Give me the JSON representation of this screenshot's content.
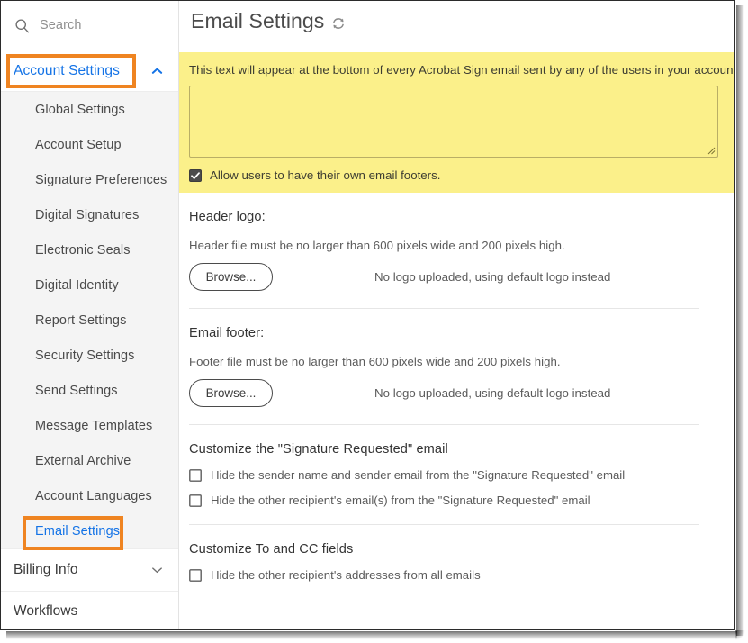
{
  "colors": {
    "accent_orange": "#ef8421",
    "link_blue": "#1473e6",
    "highlight_yellow": "#fbf08a",
    "sidebar_bg": "#f4f4f4"
  },
  "sidebar": {
    "search": {
      "placeholder": "Search",
      "icon": "search-icon"
    },
    "account_settings": {
      "label": "Account Settings",
      "expanded": true,
      "chevron_icon": "chevron-up-icon",
      "highlighted": true
    },
    "items": [
      {
        "label": "Global Settings",
        "active": false
      },
      {
        "label": "Account Setup",
        "active": false
      },
      {
        "label": "Signature Preferences",
        "active": false
      },
      {
        "label": "Digital Signatures",
        "active": false
      },
      {
        "label": "Electronic Seals",
        "active": false
      },
      {
        "label": "Digital Identity",
        "active": false
      },
      {
        "label": "Report Settings",
        "active": false
      },
      {
        "label": "Security Settings",
        "active": false
      },
      {
        "label": "Send Settings",
        "active": false
      },
      {
        "label": "Message Templates",
        "active": false
      },
      {
        "label": "External Archive",
        "active": false
      },
      {
        "label": "Account Languages",
        "active": false
      },
      {
        "label": "Email Settings",
        "active": true
      }
    ],
    "billing_info": {
      "label": "Billing Info",
      "expanded": false,
      "chevron_icon": "chevron-down-icon"
    },
    "workflows": {
      "label": "Workflows"
    }
  },
  "main": {
    "title": "Email Settings",
    "refresh_icon": "refresh-icon",
    "email_footer": {
      "note": "This text will appear at the bottom of every Acrobat Sign email sent by any of the users in your account.",
      "textarea_value": "",
      "resize_handle_icon": "resize-grip-icon",
      "allow_own_footers": {
        "label": "Allow users to have their own email footers.",
        "checked": true
      }
    },
    "header_logo": {
      "title": "Header logo:",
      "description": "Header file must be no larger than 600 pixels wide and 200 pixels high.",
      "browse_label": "Browse...",
      "status": "No logo uploaded, using default logo instead"
    },
    "email_footer_logo": {
      "title": "Email footer:",
      "description": "Footer file must be no larger than 600 pixels wide and 200 pixels high.",
      "browse_label": "Browse...",
      "status": "No logo uploaded, using default logo instead"
    },
    "signature_requested": {
      "title": "Customize the \"Signature Requested\" email",
      "options": [
        {
          "label": "Hide the sender name and sender email from the \"Signature Requested\" email",
          "checked": false
        },
        {
          "label": "Hide the other recipient's email(s) from the \"Signature Requested\" email",
          "checked": false
        }
      ]
    },
    "to_cc_fields": {
      "title": "Customize To and CC fields",
      "options": [
        {
          "label": "Hide the other recipient's addresses from all emails",
          "checked": false
        }
      ]
    }
  }
}
